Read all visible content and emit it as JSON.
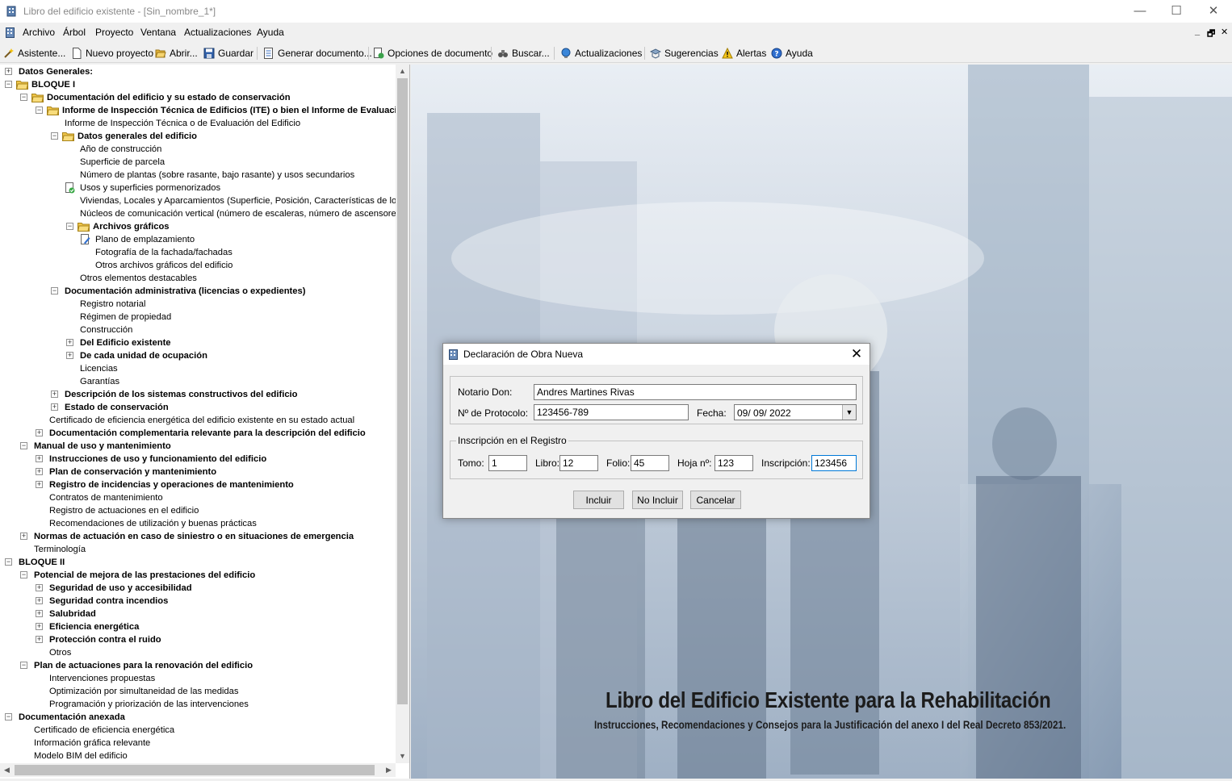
{
  "window": {
    "title": "Libro del edificio existente - [Sin_nombre_1*]",
    "minimize": "—",
    "maximize": "☐",
    "close": "✕"
  },
  "menu": {
    "items": [
      "Archivo",
      "Árbol",
      "Proyecto",
      "Ventana",
      "Actualizaciones",
      "Ayuda"
    ],
    "mdi_min": "_",
    "mdi_restore": "🗗",
    "mdi_close": "✕"
  },
  "toolbar": {
    "buttons": [
      {
        "label": "Asistente...",
        "icon": "wand-icon"
      },
      {
        "label": "Nuevo proyecto",
        "icon": "new-document-icon"
      },
      {
        "label": "Abrir...",
        "icon": "open-folder-icon"
      },
      {
        "label": "Guardar",
        "icon": "save-disk-icon"
      },
      {
        "label": "Generar documento...",
        "icon": "generate-document-icon"
      },
      {
        "label": "Opciones de documento",
        "icon": "document-options-icon"
      },
      {
        "label": "Buscar...",
        "icon": "binoculars-icon"
      },
      {
        "label": "Actualizaciones",
        "icon": "globe-update-icon"
      },
      {
        "label": "Sugerencias",
        "icon": "suggestions-icon"
      },
      {
        "label": "Alertas",
        "icon": "warning-icon"
      },
      {
        "label": "Ayuda",
        "icon": "help-icon"
      }
    ]
  },
  "tree": {
    "nodes": [
      {
        "text": "Datos Generales:",
        "level": 0,
        "bold": true,
        "exp": "plus",
        "icon": ""
      },
      {
        "text": "BLOQUE I",
        "level": 0,
        "bold": true,
        "exp": "minus",
        "icon": "folder"
      },
      {
        "text": "Documentación del edificio y su estado de conservación",
        "level": 1,
        "bold": true,
        "exp": "minus",
        "icon": "folder"
      },
      {
        "text": "Informe de Inspección Técnica de Edificios (ITE) o bien el Informe de Evaluación del Edificio (IEE)",
        "level": 2,
        "bold": true,
        "exp": "minus",
        "icon": "folder"
      },
      {
        "text": "Informe de Inspección Técnica o de Evaluación del Edificio",
        "level": 3,
        "bold": false,
        "exp": "",
        "icon": ""
      },
      {
        "text": "Datos generales del edificio",
        "level": 3,
        "bold": true,
        "exp": "minus",
        "icon": "folder"
      },
      {
        "text": "Año de construcción",
        "level": 4,
        "bold": false,
        "exp": "",
        "icon": ""
      },
      {
        "text": "Superficie de parcela",
        "level": 4,
        "bold": false,
        "exp": "",
        "icon": ""
      },
      {
        "text": "Número de plantas (sobre rasante, bajo rasante) y usos secundarios",
        "level": 4,
        "bold": false,
        "exp": "",
        "icon": ""
      },
      {
        "text": "Usos y superficies pormenorizados",
        "level": 4,
        "bold": false,
        "exp": "",
        "icon": "check-doc"
      },
      {
        "text": "Viviendas, Locales y Aparcamientos (Superficie, Posición,  Características de los mismos)",
        "level": 4,
        "bold": false,
        "exp": "",
        "icon": ""
      },
      {
        "text": "Núcleos de comunicación vertical (número de escaleras, número de ascensores)",
        "level": 4,
        "bold": false,
        "exp": "",
        "icon": ""
      },
      {
        "text": "Archivos gráficos",
        "level": 4,
        "bold": true,
        "exp": "minus",
        "icon": "folder"
      },
      {
        "text": "Plano de emplazamiento",
        "level": 5,
        "bold": false,
        "exp": "",
        "icon": "edit-doc"
      },
      {
        "text": "Fotografía de la fachada/fachadas",
        "level": 5,
        "bold": false,
        "exp": "",
        "icon": ""
      },
      {
        "text": "Otros archivos gráficos del edificio",
        "level": 5,
        "bold": false,
        "exp": "",
        "icon": ""
      },
      {
        "text": "Otros elementos destacables",
        "level": 4,
        "bold": false,
        "exp": "",
        "icon": ""
      },
      {
        "text": "Documentación administrativa (licencias o expedientes)",
        "level": 3,
        "bold": true,
        "exp": "minus",
        "icon": ""
      },
      {
        "text": "Registro notarial",
        "level": 4,
        "bold": false,
        "exp": "",
        "icon": ""
      },
      {
        "text": "Régimen de propiedad",
        "level": 4,
        "bold": false,
        "exp": "",
        "icon": ""
      },
      {
        "text": "Construcción",
        "level": 4,
        "bold": false,
        "exp": "",
        "icon": ""
      },
      {
        "text": "Del Edificio existente",
        "level": 4,
        "bold": true,
        "exp": "plus",
        "icon": ""
      },
      {
        "text": "De cada unidad de ocupación",
        "level": 4,
        "bold": true,
        "exp": "plus",
        "icon": ""
      },
      {
        "text": "Licencias",
        "level": 4,
        "bold": false,
        "exp": "",
        "icon": ""
      },
      {
        "text": "Garantías",
        "level": 4,
        "bold": false,
        "exp": "",
        "icon": ""
      },
      {
        "text": "Descripción de los sistemas constructivos del edificio",
        "level": 3,
        "bold": true,
        "exp": "plus",
        "icon": ""
      },
      {
        "text": "Estado de conservación",
        "level": 3,
        "bold": true,
        "exp": "plus",
        "icon": ""
      },
      {
        "text": "Certificado de eficiencia energética del edificio existente en su estado actual",
        "level": 2,
        "bold": false,
        "exp": "",
        "icon": ""
      },
      {
        "text": "Documentación complementaria relevante para la descripción del edificio",
        "level": 2,
        "bold": true,
        "exp": "plus",
        "icon": ""
      },
      {
        "text": "Manual de uso y mantenimiento",
        "level": 1,
        "bold": true,
        "exp": "minus",
        "icon": ""
      },
      {
        "text": "Instrucciones de uso y funcionamiento del edificio",
        "level": 2,
        "bold": true,
        "exp": "plus",
        "icon": ""
      },
      {
        "text": "Plan de conservación y mantenimiento",
        "level": 2,
        "bold": true,
        "exp": "plus",
        "icon": ""
      },
      {
        "text": "Registro de incidencias y operaciones de mantenimiento",
        "level": 2,
        "bold": true,
        "exp": "plus",
        "icon": ""
      },
      {
        "text": "Contratos de mantenimiento",
        "level": 2,
        "bold": false,
        "exp": "",
        "icon": ""
      },
      {
        "text": "Registro de actuaciones en el edificio",
        "level": 2,
        "bold": false,
        "exp": "",
        "icon": ""
      },
      {
        "text": "Recomendaciones de utilización y buenas prácticas",
        "level": 2,
        "bold": false,
        "exp": "",
        "icon": ""
      },
      {
        "text": "Normas de actuación en caso de siniestro o en situaciones de emergencia",
        "level": 1,
        "bold": true,
        "exp": "plus",
        "icon": ""
      },
      {
        "text": "Terminología",
        "level": 1,
        "bold": false,
        "exp": "",
        "icon": ""
      },
      {
        "text": "BLOQUE II",
        "level": 0,
        "bold": true,
        "exp": "minus",
        "icon": ""
      },
      {
        "text": "Potencial de mejora de las prestaciones del edificio",
        "level": 1,
        "bold": true,
        "exp": "minus",
        "icon": ""
      },
      {
        "text": "Seguridad de uso y accesibilidad",
        "level": 2,
        "bold": true,
        "exp": "plus",
        "icon": ""
      },
      {
        "text": "Seguridad contra incendios",
        "level": 2,
        "bold": true,
        "exp": "plus",
        "icon": ""
      },
      {
        "text": "Salubridad",
        "level": 2,
        "bold": true,
        "exp": "plus",
        "icon": ""
      },
      {
        "text": "Eficiencia energética",
        "level": 2,
        "bold": true,
        "exp": "plus",
        "icon": ""
      },
      {
        "text": "Protección contra el ruido",
        "level": 2,
        "bold": true,
        "exp": "plus",
        "icon": ""
      },
      {
        "text": "Otros",
        "level": 2,
        "bold": false,
        "exp": "",
        "icon": ""
      },
      {
        "text": "Plan de actuaciones para la renovación del edificio",
        "level": 1,
        "bold": true,
        "exp": "minus",
        "icon": ""
      },
      {
        "text": "Intervenciones propuestas",
        "level": 2,
        "bold": false,
        "exp": "",
        "icon": ""
      },
      {
        "text": "Optimización por simultaneidad de las medidas",
        "level": 2,
        "bold": false,
        "exp": "",
        "icon": ""
      },
      {
        "text": "Programación y priorización de las intervenciones",
        "level": 2,
        "bold": false,
        "exp": "",
        "icon": ""
      },
      {
        "text": "Documentación anexada",
        "level": 0,
        "bold": true,
        "exp": "minus",
        "icon": ""
      },
      {
        "text": "Certificado de eficiencia energética",
        "level": 1,
        "bold": false,
        "exp": "",
        "icon": ""
      },
      {
        "text": "Información gráfica relevante",
        "level": 1,
        "bold": false,
        "exp": "",
        "icon": ""
      },
      {
        "text": "Modelo BIM del edificio",
        "level": 1,
        "bold": false,
        "exp": "",
        "icon": ""
      }
    ]
  },
  "background": {
    "title": "Libro del Edificio Existente para la Rehabilitación",
    "subtitle": "Instrucciones, Recomendaciones y Consejos para la Justificación del anexo I del Real Decreto 853/2021."
  },
  "dialog": {
    "title": "Declaración de Obra Nueva",
    "notario_label": "Notario Don:",
    "notario_value": "Andres Martines Rivas",
    "protocolo_label": "Nº de Protocolo:",
    "protocolo_value": "123456-789",
    "fecha_label": "Fecha:",
    "fecha_value": "09/ 09/ 2022",
    "registro_group": "Inscripción en el Registro",
    "tomo_label": "Tomo:",
    "tomo_value": "1",
    "libro_label": "Libro:",
    "libro_value": "12",
    "folio_label": "Folio:",
    "folio_value": "45",
    "hoja_label": "Hoja nº:",
    "hoja_value": "123",
    "inscripcion_label": "Inscripción:",
    "inscripcion_value": "123456",
    "btn_incluir": "Incluir",
    "btn_no_incluir": "No Incluir",
    "btn_cancelar": "Cancelar"
  }
}
